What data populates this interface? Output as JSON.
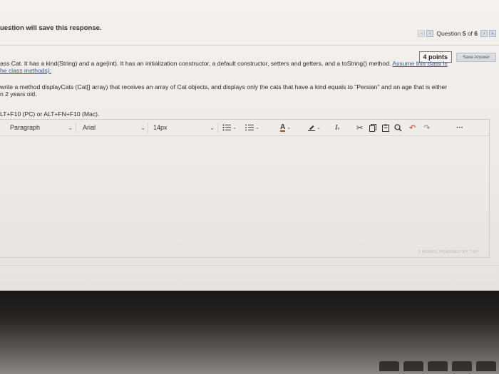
{
  "header": {
    "note": "uestion will save this response."
  },
  "question_nav": {
    "first_icon": "double-chevron-left-icon",
    "prev_icon": "chevron-left-icon",
    "label_prefix": "Question ",
    "current": "5",
    "label_mid": " of ",
    "total": "6",
    "next_icon": "chevron-right-icon",
    "last_icon": "double-chevron-right-icon"
  },
  "points": {
    "label": "4 points",
    "save_label": "Save Answer"
  },
  "question": {
    "line1_text": "ass Cat. It has a kind(String) and a age(int). It has an initialization constructor, a default constructor, setters and getters, and a toString() method.",
    "line1_link": "Assume this class is",
    "line2_link": "he class methods).",
    "line3": "write a method displayCats (Cat[] array) that receives an array of Cat objects, and displays only the cats that have a kind equals to \"Persian\" and an age that is either",
    "line4": "n 2 years old."
  },
  "hint": "LT+F10 (PC) or ALT+FN+F10 (Mac).",
  "toolbar": {
    "paragraph": "Paragraph",
    "font": "Arial",
    "size": "14px",
    "more": "···"
  },
  "editor_footer": {
    "words": "0 WORDS",
    "powered": "POWERED BY TINY"
  },
  "colors": {
    "link": "#2f5b9a",
    "nav_button": "#d7dde6"
  }
}
